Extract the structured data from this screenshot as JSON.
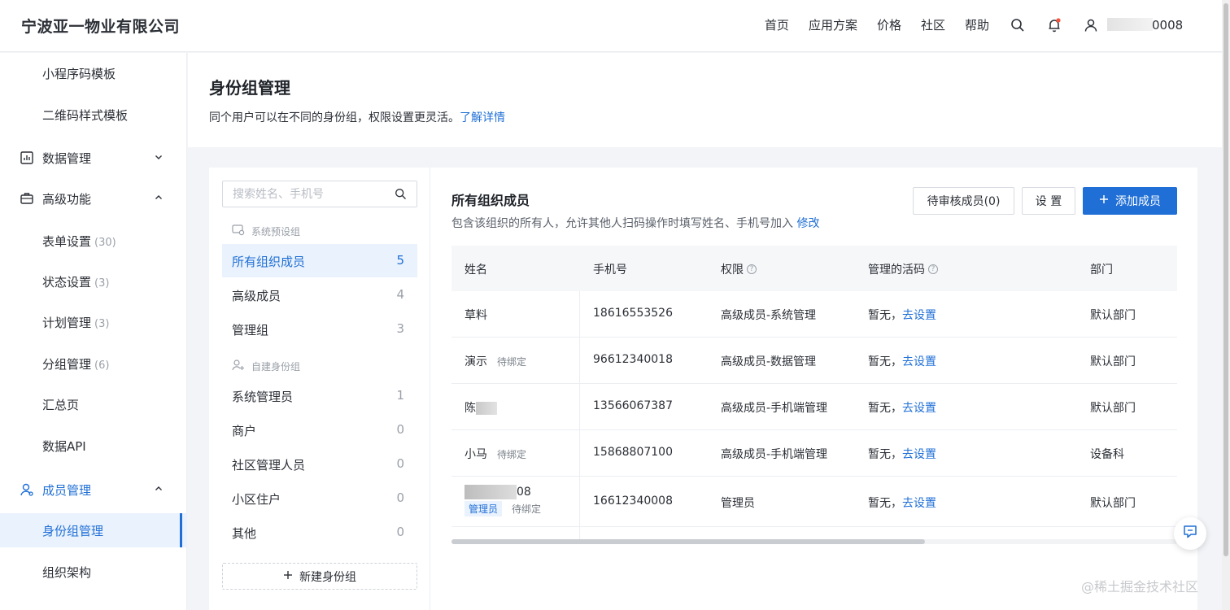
{
  "header": {
    "brand": "宁波亚一物业有限公司",
    "nav": [
      "首页",
      "应用方案",
      "价格",
      "社区",
      "帮助"
    ],
    "user_id_suffix": "0008",
    "icons": [
      "search-icon",
      "bell-icon",
      "user-icon"
    ],
    "notification_dot_color": "#f5533d"
  },
  "sidebar": {
    "items": [
      {
        "label": "小程序码模板",
        "count": ""
      },
      {
        "label": "二维码样式模板",
        "count": ""
      },
      {
        "label": "数据管理",
        "count": "",
        "icon": "chart-icon",
        "expand": "chevron-down"
      },
      {
        "label": "高级功能",
        "count": "",
        "icon": "briefcase-icon",
        "expand": "chevron-up"
      },
      {
        "label": "表单设置",
        "count": "(30)"
      },
      {
        "label": "状态设置",
        "count": "(3)"
      },
      {
        "label": "计划管理",
        "count": "(3)"
      },
      {
        "label": "分组管理",
        "count": "(6)"
      },
      {
        "label": "汇总页",
        "count": ""
      },
      {
        "label": "数据API",
        "count": ""
      },
      {
        "label": "成员管理",
        "count": "",
        "icon": "member-icon",
        "expand": "chevron-up"
      },
      {
        "label": "身份组管理",
        "count": "",
        "active": true
      },
      {
        "label": "组织架构",
        "count": ""
      }
    ]
  },
  "page": {
    "title": "身份组管理",
    "description": "同个用户可以在不同的身份组，权限设置更灵活。",
    "learn_more": "了解详情"
  },
  "groups": {
    "search_placeholder": "搜索姓名、手机号",
    "preset_section": "系统预设组",
    "preset": [
      {
        "name": "所有组织成员",
        "count": "5",
        "active": true
      },
      {
        "name": "高级成员",
        "count": "4"
      },
      {
        "name": "管理组",
        "count": "3"
      }
    ],
    "custom_section": "自建身份组",
    "custom": [
      {
        "name": "系统管理员",
        "count": "1"
      },
      {
        "name": "商户",
        "count": "0"
      },
      {
        "name": "社区管理人员",
        "count": "0"
      },
      {
        "name": "小区住户",
        "count": "0"
      },
      {
        "name": "其他",
        "count": "0"
      }
    ],
    "new_group": "新建身份组"
  },
  "members": {
    "title": "所有组织成员",
    "description": "包含该组织的所有人，允许其他人扫码操作时填写姓名、手机号加入",
    "edit_link": "修改",
    "pending_button": "待审核成员(0)",
    "settings_button": "设 置",
    "add_button": "添加成员",
    "columns": [
      "姓名",
      "手机号",
      "权限",
      "管理的活码",
      "部门"
    ],
    "rows": [
      {
        "name": "草料",
        "tag": "",
        "phone": "18616553526",
        "role": "高级成员-系统管理",
        "codes_prefix": "暂无，",
        "codes_link": "去设置",
        "dept": "默认部门"
      },
      {
        "name": "演示",
        "tag": "待绑定",
        "phone": "96612340018",
        "role": "高级成员-数据管理",
        "codes_prefix": "暂无，",
        "codes_link": "去设置",
        "dept": "默认部门"
      },
      {
        "name": "陈",
        "tag": "",
        "phone": "13566067387",
        "role": "高级成员-手机端管理",
        "codes_prefix": "暂无，",
        "codes_link": "去设置",
        "dept": "默认部门"
      },
      {
        "name": "小马",
        "tag": "待绑定",
        "phone": "15868807100",
        "role": "高级成员-手机端管理",
        "codes_prefix": "暂无，",
        "codes_link": "去设置",
        "dept": "设备科"
      },
      {
        "name": "08",
        "tag": "待绑定",
        "badge": "管理员",
        "phone": "16612340008",
        "role": "管理员",
        "codes_prefix": "暂无，",
        "codes_link": "去设置",
        "dept": "默认部门"
      }
    ]
  },
  "watermark": "@稀土掘金技术社区",
  "colors": {
    "accent": "#1f6fd6",
    "active_bg": "#eaf2fd"
  }
}
